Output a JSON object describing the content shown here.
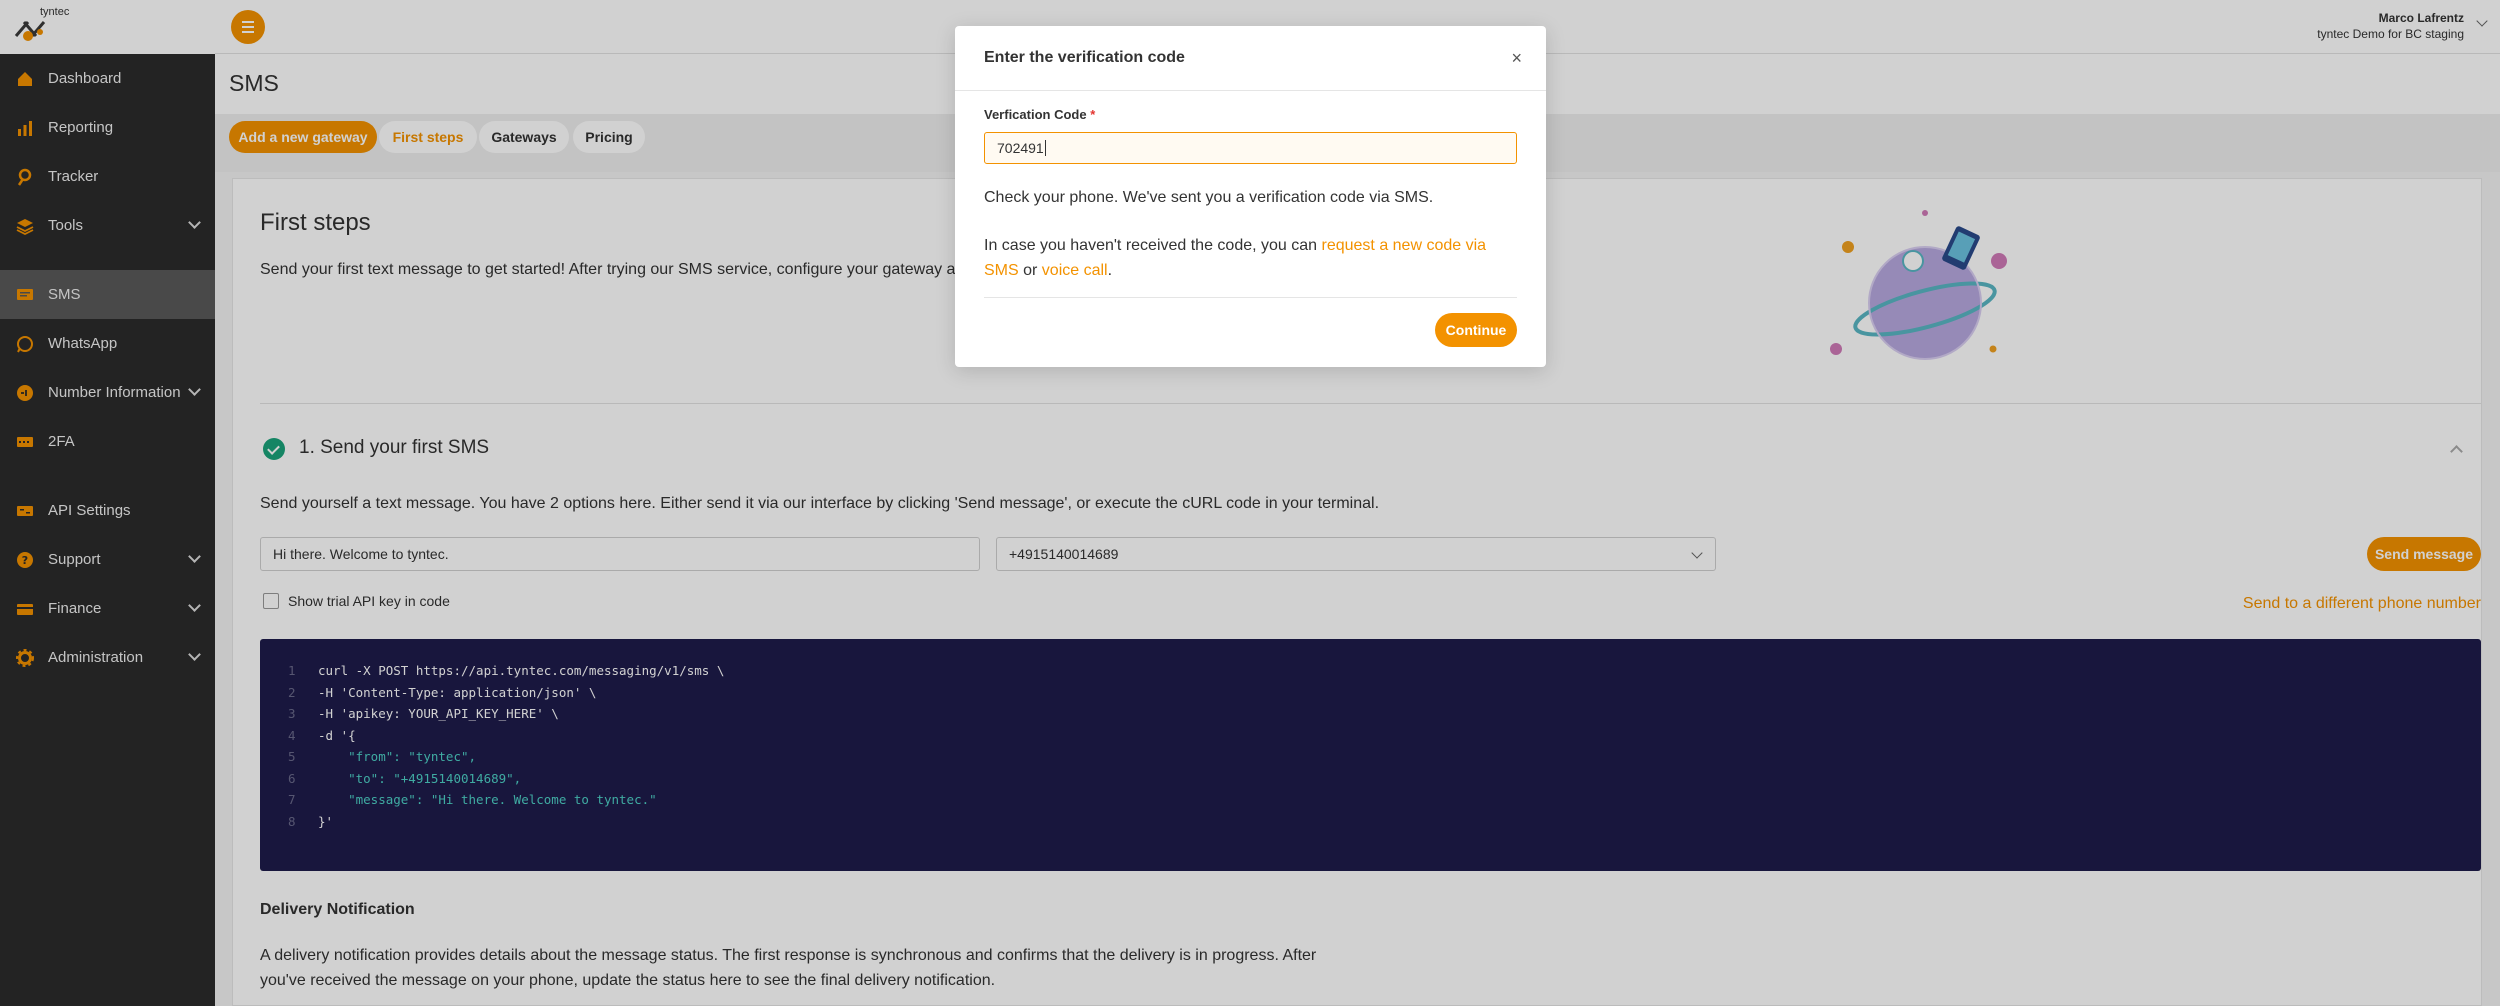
{
  "brand": {
    "logo_text": "tyntec",
    "accent": "#f39200"
  },
  "sidebar": {
    "items": [
      {
        "label": "Dashboard",
        "icon": "home-icon"
      },
      {
        "label": "Reporting",
        "icon": "bar-chart-icon"
      },
      {
        "label": "Tracker",
        "icon": "location-pin-icon"
      },
      {
        "label": "Tools",
        "icon": "layers-icon",
        "expandable": true
      },
      {
        "label": "SMS",
        "icon": "sms-icon",
        "active": true
      },
      {
        "label": "WhatsApp",
        "icon": "whatsapp-icon"
      },
      {
        "label": "Number Information",
        "icon": "number-info-icon",
        "expandable": true
      },
      {
        "label": "2FA",
        "icon": "two-factor-icon"
      },
      {
        "label": "API Settings",
        "icon": "api-settings-icon"
      },
      {
        "label": "Support",
        "icon": "help-icon",
        "expandable": true
      },
      {
        "label": "Finance",
        "icon": "finance-icon",
        "expandable": true
      },
      {
        "label": "Administration",
        "icon": "gear-icon",
        "expandable": true
      }
    ]
  },
  "header": {
    "user_name": "Marco Lafrentz",
    "account": "tyntec Demo for BC staging"
  },
  "page": {
    "title": "SMS",
    "tabs": [
      {
        "label": "Add a new gateway"
      },
      {
        "label": "First steps"
      },
      {
        "label": "Gateways"
      },
      {
        "label": "Pricing"
      }
    ]
  },
  "first_steps": {
    "title": "First steps",
    "subtitle": "Send your first text message to get started! After trying our SMS service, configure your gateway and s",
    "step1_title": "1. Send your first SMS",
    "step1_desc": "Send yourself a text message. You have 2 options here. Either send it via our interface by clicking 'Send message', or execute the cURL code in your terminal.",
    "message_value": "Hi there. Welcome to tyntec.",
    "phone_value": "+4915140014689",
    "send_label": "Send message",
    "trial_label": "Show trial API key in code",
    "different_phone_link": "Send to a different phone number",
    "code_lines": [
      {
        "n": "1",
        "text": "curl -X POST https://api.tyntec.com/messaging/v1/sms \\"
      },
      {
        "n": "2",
        "text": "-H 'Content-Type: application/json' \\"
      },
      {
        "n": "3",
        "text": "-H 'apikey: YOUR_API_KEY_HERE' \\"
      },
      {
        "n": "4",
        "text": "-d '{"
      },
      {
        "n": "5",
        "text": "    \"from\": \"tyntec\","
      },
      {
        "n": "6",
        "text": "    \"to\": \"+4915140014689\","
      },
      {
        "n": "7",
        "text": "    \"message\": \"Hi there. Welcome to tyntec.\""
      },
      {
        "n": "8",
        "text": "}'"
      }
    ],
    "delivery_title": "Delivery Notification",
    "delivery_text": "A delivery notification provides details about the message status. The first response is synchronous and confirms that the delivery is in progress. After you've received the message on your phone, update the status here to see the final delivery notification."
  },
  "modal": {
    "title": "Enter the verification code",
    "close": "×",
    "field_label": "Verfication Code",
    "required_mark": "*",
    "code_value": "702491",
    "text1": "Check your phone. We've sent you a verification code via SMS.",
    "text2_prefix": "In case you haven't received the code, you can ",
    "link_sms": "request a new code via SMS",
    "text2_mid": " or ",
    "link_voice": "voice call",
    "text2_suffix": ".",
    "continue_label": "Continue"
  }
}
